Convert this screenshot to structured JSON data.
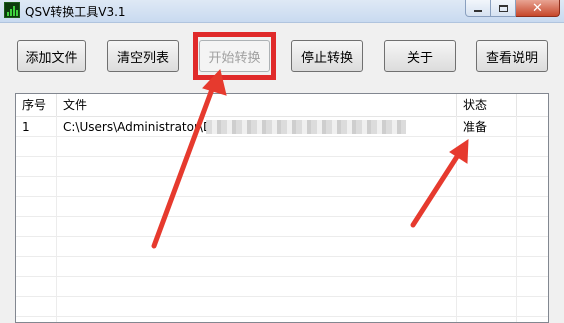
{
  "window": {
    "title": "QSV转换工具V3.1",
    "icon": "app-icon",
    "controls": [
      "minimize-icon",
      "maximize-icon",
      "close-icon"
    ],
    "close_glyph": "✕"
  },
  "toolbar": {
    "add_file": "添加文件",
    "clear_list": "清空列表",
    "start_convert": "开始转换",
    "start_convert_enabled": false,
    "stop_convert": "停止转换",
    "about": "关于",
    "view_help": "查看说明"
  },
  "file_list": {
    "columns": [
      "序号",
      "文件",
      "状态"
    ],
    "rows": [
      {
        "index": "1",
        "path": "C:\\Users\\Administrator\\D",
        "status": "准备"
      }
    ]
  },
  "colors": {
    "annotation_red": "#e02a2a",
    "titlebar": "#dfe9f5",
    "window_bg": "#f0f0f0"
  }
}
